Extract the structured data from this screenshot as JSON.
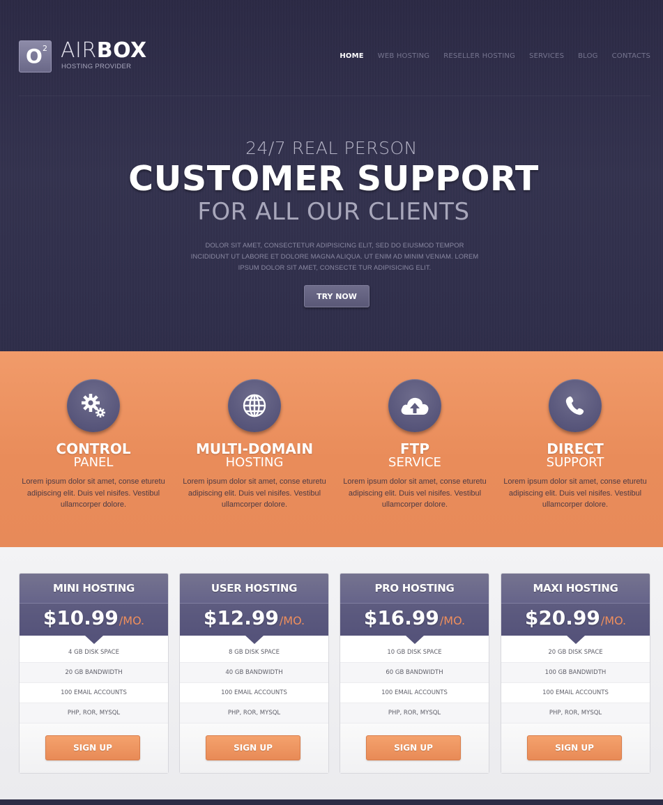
{
  "brand": {
    "logo_letter": "O",
    "logo_sup": "2",
    "name_light": "AIR",
    "name_bold": "BOX",
    "tagline": "HOSTING PROVIDER"
  },
  "nav": {
    "items": [
      "HOME",
      "WEB HOSTING",
      "RESELLER HOSTING",
      "SERVICES",
      "BLOG",
      "CONTACTS"
    ],
    "active": "HOME"
  },
  "hero": {
    "line1": "24/7 REAL PERSON",
    "line2": "CUSTOMER SUPPORT",
    "line3": "FOR ALL OUR CLIENTS",
    "description": "DOLOR SIT AMET, CONSECTETUR ADIPISICING ELIT, SED DO EIUSMOD TEMPOR INCIDIDUNT UT LABORE ET DOLORE MAGNA ALIQUA. UT ENIM AD MINIM VENIAM. LOREM IPSUM DOLOR SIT AMET, CONSECTE TUR ADIPISICING ELIT.",
    "cta": "TRY NOW"
  },
  "features": [
    {
      "icon": "gears-icon",
      "title": "CONTROL",
      "subtitle": "PANEL",
      "text": "Lorem ipsum dolor sit amet, conse eturetu adipiscing elit. Duis vel nisifes. Vestibul ullamcorper dolore."
    },
    {
      "icon": "globe-icon",
      "title": "MULTI-DOMAIN",
      "subtitle": "HOSTING",
      "text": "Lorem ipsum dolor sit amet, conse eturetu adipiscing elit. Duis vel nisifes. Vestibul ullamcorper dolore."
    },
    {
      "icon": "cloud-upload-icon",
      "title": "FTP",
      "subtitle": "SERVICE",
      "text": "Lorem ipsum dolor sit amet, conse eturetu adipiscing elit. Duis vel nisifes. Vestibul ullamcorper dolore."
    },
    {
      "icon": "phone-icon",
      "title": "DIRECT",
      "subtitle": "SUPPORT",
      "text": "Lorem ipsum dolor sit amet, conse eturetu adipiscing elit. Duis vel nisifes. Vestibul ullamcorper dolore."
    }
  ],
  "plans": [
    {
      "name": "MINI HOSTING",
      "price": "$10.99",
      "per": "/MO.",
      "rows": [
        "4 GB DISK SPACE",
        "20 GB BANDWIDTH",
        "100 EMAIL ACCOUNTS",
        "PHP, ROR, MYSQL"
      ],
      "cta": "SIGN UP"
    },
    {
      "name": "USER HOSTING",
      "price": "$12.99",
      "per": "/MO.",
      "rows": [
        "8 GB DISK SPACE",
        "40 GB BANDWIDTH",
        "100 EMAIL ACCOUNTS",
        "PHP, ROR, MYSQL"
      ],
      "cta": "SIGN UP"
    },
    {
      "name": "PRO HOSTING",
      "price": "$16.99",
      "per": "/MO.",
      "rows": [
        "10 GB DISK SPACE",
        "60 GB BANDWIDTH",
        "100 EMAIL ACCOUNTS",
        "PHP, ROR, MYSQL"
      ],
      "cta": "SIGN UP"
    },
    {
      "name": "MAXI HOSTING",
      "price": "$20.99",
      "per": "/MO.",
      "rows": [
        "20 GB DISK SPACE",
        "100 GB BANDWIDTH",
        "100 EMAIL ACCOUNTS",
        "PHP, ROR, MYSQL"
      ],
      "cta": "SIGN UP"
    }
  ],
  "colors": {
    "hero_bg": "#2f2e4a",
    "accent_orange": "#ec925f",
    "plan_purple": "#5e5c80"
  }
}
